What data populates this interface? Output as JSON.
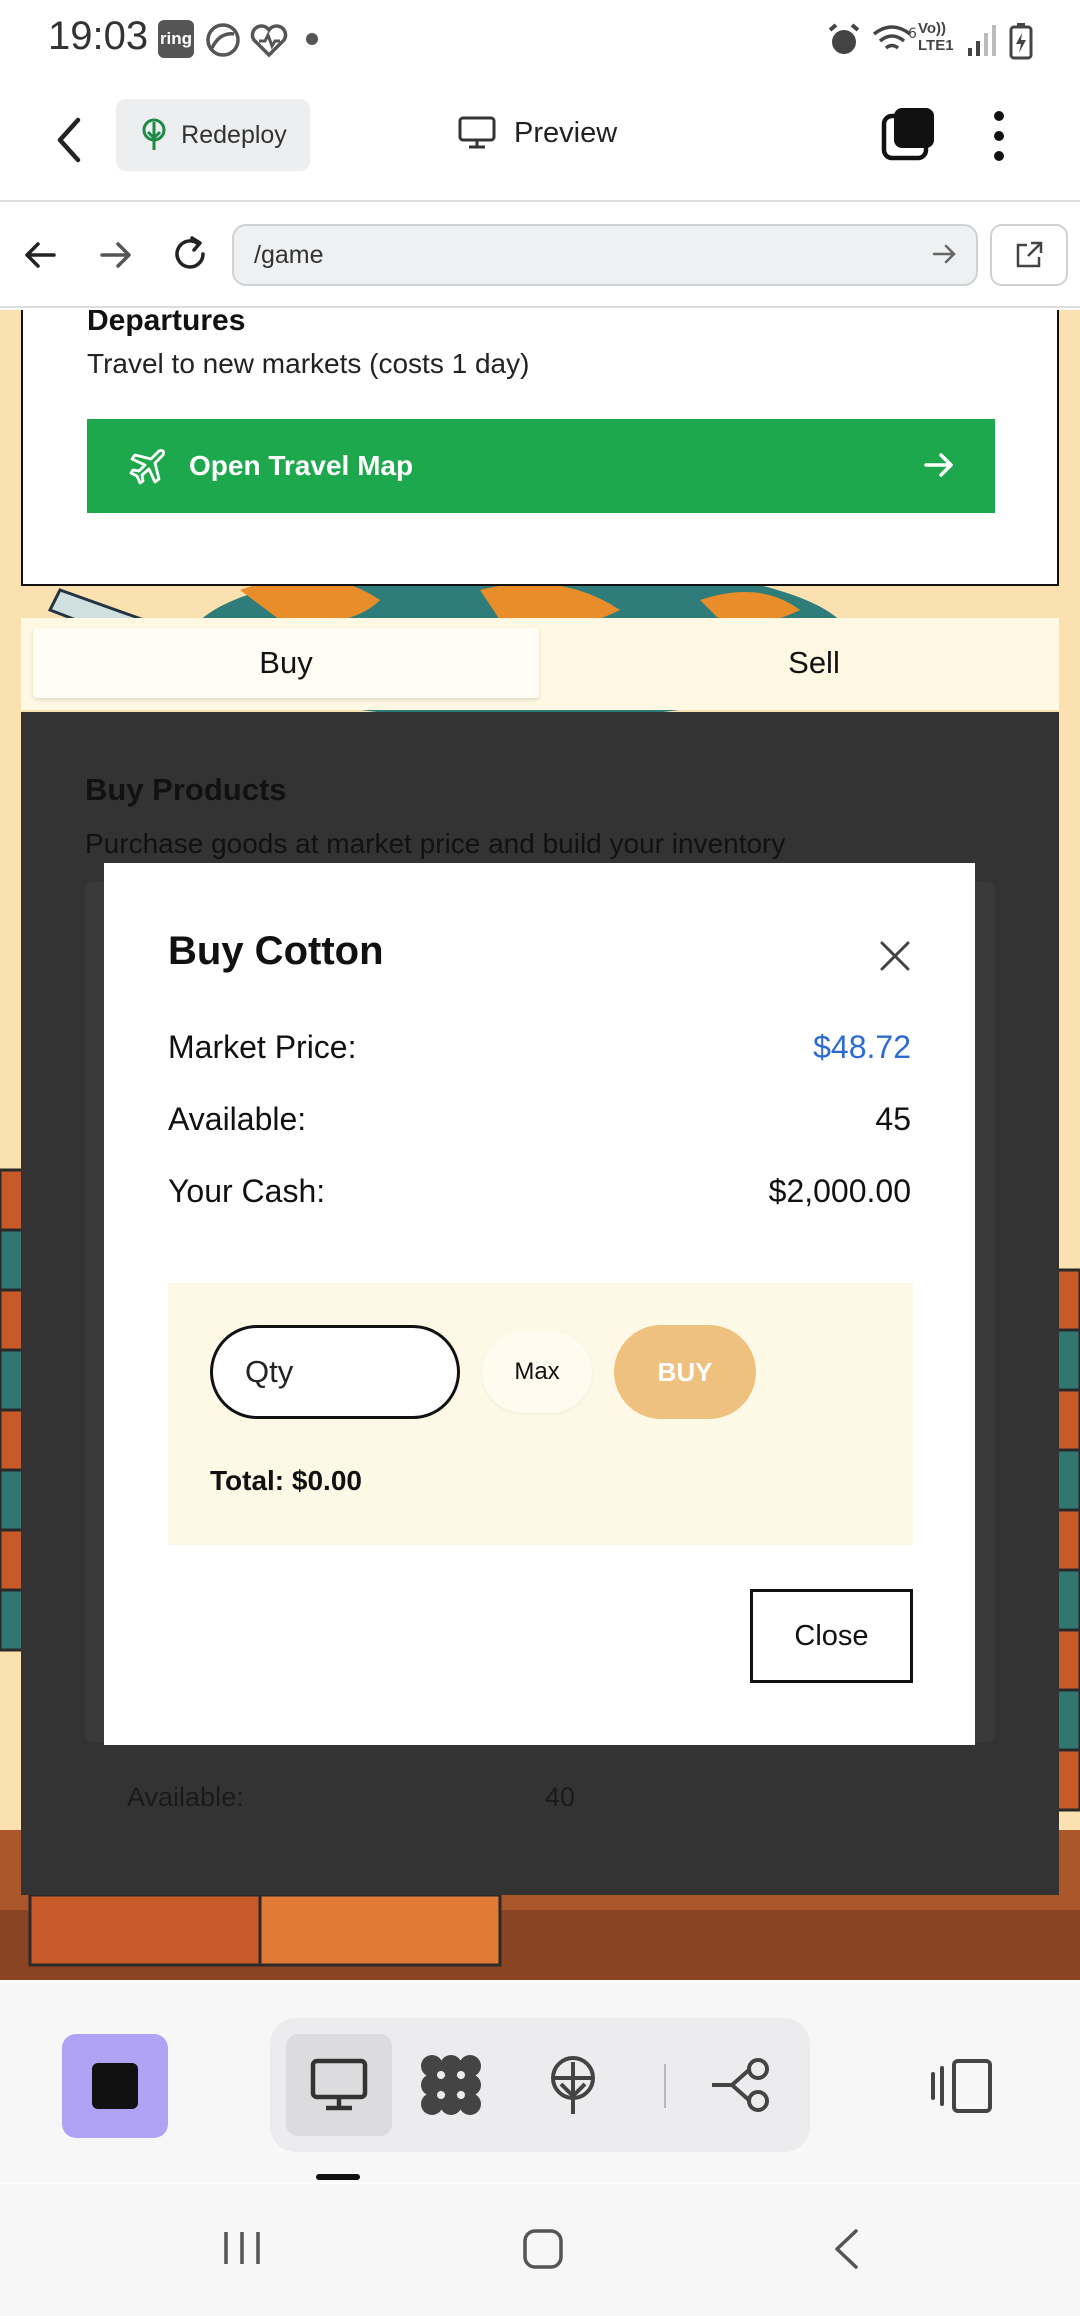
{
  "status_bar": {
    "time": "19:03",
    "ring_badge": "ring",
    "icons": [
      "ring-app-icon",
      "cloud-icon",
      "health-icon",
      "dot-icon",
      "alarm-icon",
      "wifi-icon",
      "volte-icon",
      "signal-icon",
      "battery-icon"
    ],
    "volte_text": "Vo)) LTE1"
  },
  "app_header": {
    "redeploy_label": "Redeploy",
    "preview_label": "Preview"
  },
  "browser": {
    "url": "/game"
  },
  "departures": {
    "title": "Departures",
    "description": "Travel to new markets (costs 1 day)",
    "button_label": "Open Travel Map"
  },
  "tabs": {
    "buy": "Buy",
    "sell": "Sell"
  },
  "buy_panel": {
    "title": "Buy Products",
    "description": "Purchase goods at market price and build your inventory",
    "available_label": "Available:",
    "available_value": "40"
  },
  "modal": {
    "title": "Buy Cotton",
    "rows": [
      {
        "label": "Market Price:",
        "value": "$48.72"
      },
      {
        "label": "Available:",
        "value": "45"
      },
      {
        "label": "Your Cash:",
        "value": "$2,000.00"
      }
    ],
    "qty_placeholder": "Qty",
    "max_label": "Max",
    "buy_label": "BUY",
    "total_text": "Total: $0.00",
    "close_label": "Close"
  },
  "colors": {
    "accent_green": "#1ea84d",
    "price_blue": "#2e6bd1",
    "buy_button": "#eec17f",
    "stop_button": "#b0a3f5"
  }
}
